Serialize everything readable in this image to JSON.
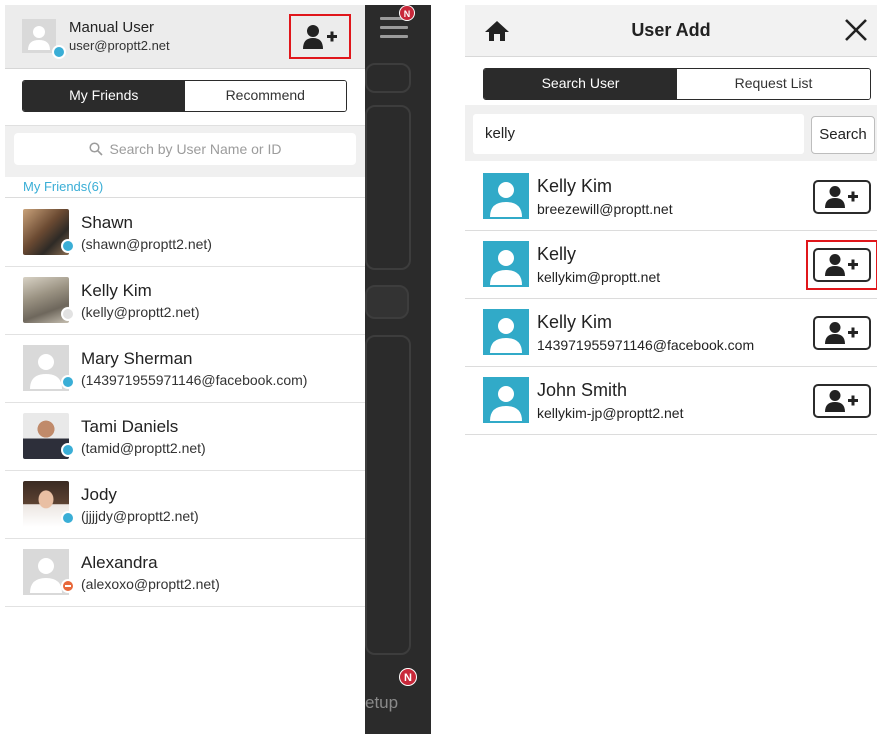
{
  "drawer": {
    "user_name": "Manual User",
    "user_email": "user@proptt2.net",
    "tabs": [
      "My Friends",
      "Recommend"
    ],
    "search_placeholder": "Search by User Name or ID",
    "group_label": "My Friends(6)",
    "friends": [
      {
        "name": "Shawn",
        "email": "(shawn@proptt2.net)",
        "status": "online",
        "photo": "photo"
      },
      {
        "name": "Kelly Kim",
        "email": "(kelly@proptt2.net)",
        "status": "away",
        "photo": "photo"
      },
      {
        "name": "Mary Sherman",
        "email": "(143971955971146@facebook.com)",
        "status": "online",
        "photo": "placeholder"
      },
      {
        "name": "Tami Daniels",
        "email": "(tamid@proptt2.net)",
        "status": "online",
        "photo": "photo"
      },
      {
        "name": "Jody",
        "email": "(jjjjdy@proptt2.net)",
        "status": "online",
        "photo": "photo"
      },
      {
        "name": "Alexandra",
        "email": "(alexoxo@proptt2.net)",
        "status": "busy",
        "photo": "placeholder"
      }
    ]
  },
  "background_app": {
    "badge_top": "N",
    "badge_bottom": "N",
    "setup_label": "etup"
  },
  "user_add": {
    "title": "User Add",
    "tabs": [
      "Search User",
      "Request List"
    ],
    "search_value": "kelly",
    "search_button": "Search",
    "results": [
      {
        "name": "Kelly Kim",
        "email": "breezewill@proptt.net"
      },
      {
        "name": "Kelly",
        "email": "kellykim@proptt.net"
      },
      {
        "name": "Kelly Kim",
        "email": "143971955971146@facebook.com"
      },
      {
        "name": "John Smith",
        "email": "kellykim-jp@proptt2.net"
      }
    ]
  },
  "colors": {
    "accent": "#3aaed6",
    "highlight": "#e0161b",
    "dark": "#2b2b2b",
    "avatar_teal": "#31aac8"
  }
}
